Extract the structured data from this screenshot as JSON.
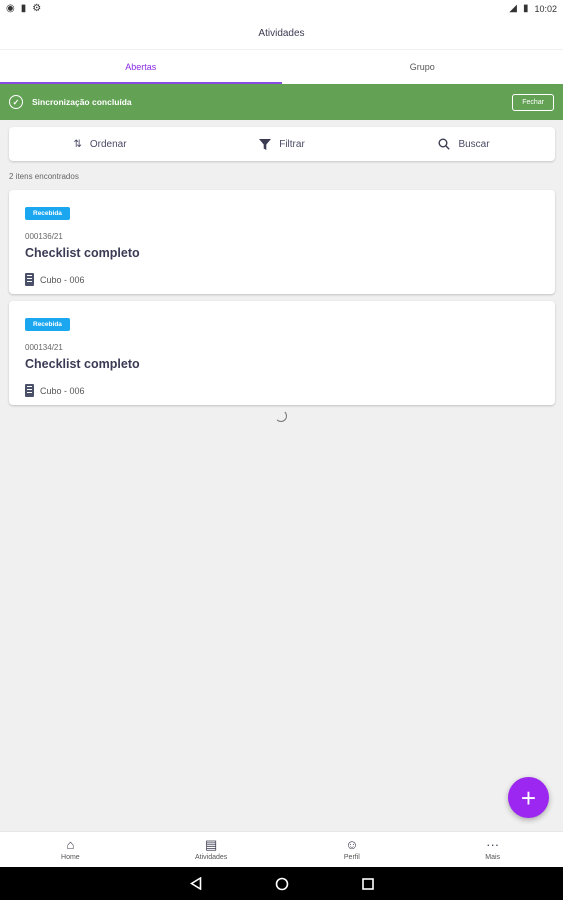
{
  "status_bar": {
    "left_icons": [
      "notification-icon",
      "sim-icon",
      "settings-icon"
    ],
    "signal_icon": "signal-icon",
    "battery_icon": "battery-icon",
    "time": "10:02"
  },
  "app_bar": {
    "title": "Atividades"
  },
  "tabs": [
    {
      "label": "Abertas",
      "active": true
    },
    {
      "label": "Grupo",
      "active": false
    }
  ],
  "banner": {
    "text": "Sincronização concluída",
    "close_label": "Fechar",
    "color": "#63a255"
  },
  "toolbar": {
    "order_label": "Ordenar",
    "filter_label": "Filtrar",
    "search_label": "Buscar"
  },
  "result_count": "2 itens encontrados",
  "items": [
    {
      "badge": "Recebida",
      "code": "000136/21",
      "title": "Checklist completo",
      "location": "Cubo - 006"
    },
    {
      "badge": "Recebida",
      "code": "000134/21",
      "title": "Checklist completo",
      "location": "Cubo - 006"
    }
  ],
  "fab": {
    "icon": "plus-icon",
    "color": "#9b27f0"
  },
  "bottom_nav": [
    {
      "label": "Home",
      "icon": "home-icon"
    },
    {
      "label": "Atividades",
      "icon": "inbox-icon"
    },
    {
      "label": "Perfil",
      "icon": "profile-icon"
    },
    {
      "label": "Mais",
      "icon": "more-icon"
    }
  ],
  "colors": {
    "accent": "#8a2be2",
    "badge": "#1aa7f0",
    "success": "#63a255"
  }
}
